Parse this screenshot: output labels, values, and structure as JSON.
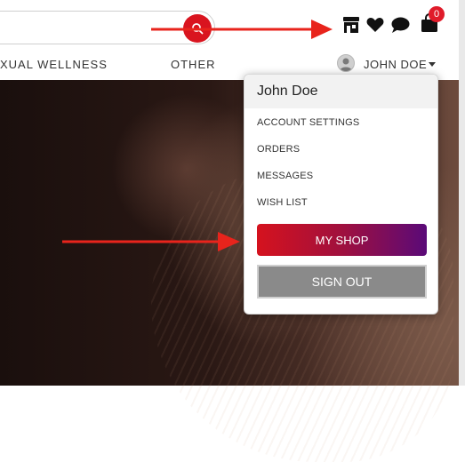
{
  "header": {
    "search": {
      "placeholder": ""
    },
    "cart_count": "0",
    "icons": [
      "store-icon",
      "heart-icon",
      "chat-bubble-icon",
      "shopping-bag-icon"
    ]
  },
  "nav": {
    "items": [
      "XUAL WELLNESS",
      "OTHER"
    ]
  },
  "user": {
    "name": "JOHN DOE"
  },
  "dropdown": {
    "name": "John Doe",
    "items": [
      "ACCOUNT SETTINGS",
      "ORDERS",
      "MESSAGES",
      "WISH LIST"
    ],
    "my_shop": "MY SHOP",
    "sign_out": "SIGN OUT"
  },
  "colors": {
    "brand_red": "#d9141f",
    "myshop_gradient_start": "#d5121e",
    "myshop_gradient_end": "#5a0a78",
    "signout_gray": "#8a8a8a",
    "annotation_arrow": "#e8241c"
  }
}
